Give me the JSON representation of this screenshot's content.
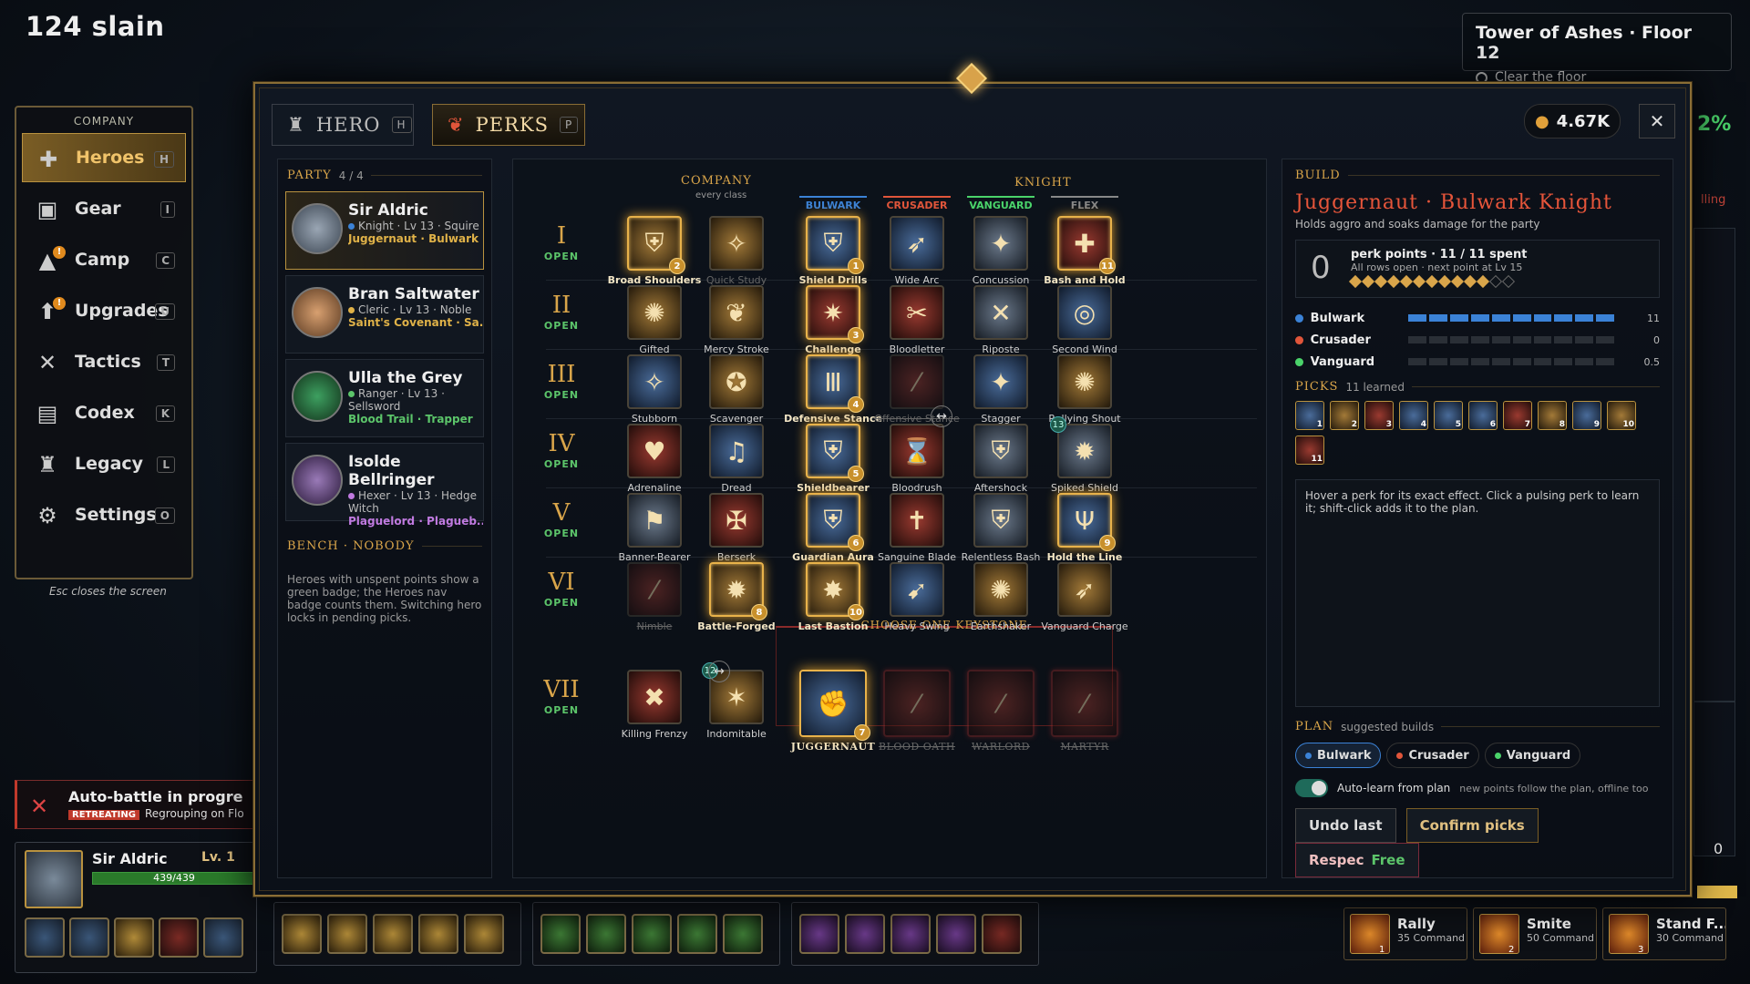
{
  "hud": {
    "slain": "124 slain",
    "quest_title": "Tower of Ashes · Floor 12",
    "quest_obj": "Clear the floor",
    "pct": "2%",
    "illing": "lling",
    "bg_num": "0"
  },
  "nav": {
    "header": "COMPANY",
    "items": [
      {
        "label": "Heroes",
        "key": "H",
        "icon": "✚"
      },
      {
        "label": "Gear",
        "key": "I",
        "icon": "▣"
      },
      {
        "label": "Camp",
        "key": "C",
        "icon": "▲"
      },
      {
        "label": "Upgrades",
        "key": "U",
        "icon": "⬆"
      },
      {
        "label": "Tactics",
        "key": "T",
        "icon": "✕"
      },
      {
        "label": "Codex",
        "key": "K",
        "icon": "▤"
      },
      {
        "label": "Legacy",
        "key": "L",
        "icon": "♜"
      },
      {
        "label": "Settings",
        "key": "O",
        "icon": "⚙"
      }
    ],
    "esc": "Esc closes the screen"
  },
  "auto": {
    "title": "Auto-battle in progress...",
    "tag": "RETREATING",
    "sub": "Regrouping on Flo"
  },
  "hero_card": {
    "name": "Sir Aldric",
    "lv": "Lv. 1",
    "hp": "439/439"
  },
  "commands": [
    {
      "name": "Rally",
      "cost": "35 Command",
      "key": "1"
    },
    {
      "name": "Smite",
      "cost": "50 Command",
      "key": "2"
    },
    {
      "name": "Stand F...",
      "cost": "30 Command",
      "key": "3"
    }
  ],
  "window": {
    "tab_hero": "HERO",
    "tab_hero_key": "H",
    "tab_perks": "PERKS",
    "tab_perks_key": "P",
    "gold": "4.67K",
    "close": "✕"
  },
  "party": {
    "header": "PARTY",
    "count": "4 / 4",
    "members": [
      {
        "name": "Sir Aldric",
        "desc": "Knight · Lv 13 · Squire",
        "spec": "Juggernaut · Bulwark",
        "dot": "#3b82d6"
      },
      {
        "name": "Bran Saltwater",
        "desc": "Cleric · Lv 13 · Noble",
        "spec": "Saint's Covenant · Sa...",
        "dot": "#e0b248"
      },
      {
        "name": "Ulla the Grey",
        "desc": "Ranger · Lv 13 · Sellsword",
        "spec": "Blood Trail · Trapper",
        "dot": "#5cc56a"
      },
      {
        "name": "Isolde Bellringer",
        "desc": "Hexer · Lv 13 · Hedge Witch",
        "spec": "Plaguelord · Plagueb...",
        "dot": "#c07ae0"
      }
    ],
    "bench": "BENCH · NOBODY",
    "note": "Heroes with unspent points show a green badge; the Heroes nav badge counts them. Switching hero locks in pending picks."
  },
  "grid": {
    "company": "COMPANY",
    "company_sub": "every class",
    "knight": "KNIGHT",
    "subcols": [
      {
        "name": "BULWARK",
        "color": "#3b82d6"
      },
      {
        "name": "CRUSADER",
        "color": "#e0553a"
      },
      {
        "name": "VANGUARD",
        "color": "#4ad36a"
      },
      {
        "name": "FLEX",
        "color": "#888888"
      }
    ],
    "rows": [
      "I",
      "II",
      "III",
      "IV",
      "V",
      "VI",
      "VII"
    ],
    "open": "OPEN",
    "keystone": "CHOOSE ONE KEYSTONE",
    "perks": [
      [
        "Broad Shoulders",
        "Quick Study",
        "Shield Drills",
        "Wide Arc",
        "Concussion",
        "Bash and Hold"
      ],
      [
        "Gifted",
        "Mercy Stroke",
        "Challenge",
        "Bloodletter",
        "Riposte",
        "Second Wind"
      ],
      [
        "Stubborn",
        "Scavenger",
        "Defensive Stance",
        "Offensive Stance",
        "Stagger",
        "Rallying Shout"
      ],
      [
        "Adrenaline",
        "Dread",
        "Shieldbearer",
        "Bloodrush",
        "Aftershock",
        "Spiked Shield"
      ],
      [
        "Banner-Bearer",
        "Berserk",
        "Guardian Aura",
        "Sanguine Blade",
        "Relentless Bash",
        "Hold the Line"
      ],
      [
        "Nimble",
        "Battle-Forged",
        "Last Bastion",
        "Heavy Swing",
        "Earthshaker",
        "Vanguard Charge"
      ],
      [
        "Killing Frenzy",
        "Indomitable",
        "JUGGERNAUT",
        "BLOOD OATH",
        "WARLORD",
        "MARTYR"
      ]
    ],
    "nums": {
      "0-0": "2",
      "0-2": "1",
      "0-5": "11",
      "1-2": "3",
      "2-2": "4",
      "3-2": "5",
      "4-2": "6",
      "4-5": "9",
      "5-1": "8",
      "5-2": "10",
      "6-2": "7"
    },
    "tnums": {
      "3-5": "13",
      "6-1": "12"
    }
  },
  "build": {
    "header": "BUILD",
    "title": "Juggernaut · Bulwark Knight",
    "desc": "Holds aggro and soaks damage for the party",
    "pp_big": "0",
    "pp_title": "perk points · 11 / 11 spent",
    "pp_sub": "All rows open · next point at Lv 15",
    "pp_filled": 11,
    "pp_total": 13,
    "aff": [
      {
        "name": "Bulwark",
        "color": "#3b82d6",
        "value": "11",
        "fill": 10
      },
      {
        "name": "Crusader",
        "color": "#e0553a",
        "value": "0",
        "fill": 0
      },
      {
        "name": "Vanguard",
        "color": "#4ad36a",
        "value": "0.5",
        "fill": 0
      }
    ],
    "picks_hdr": "PICKS",
    "picks_sub": "11 learned",
    "picks": [
      "1",
      "2",
      "3",
      "4",
      "5",
      "6",
      "7",
      "8",
      "9",
      "10",
      "11"
    ],
    "hover": "Hover a perk for its exact effect. Click a pulsing perk to learn it; shift-click adds it to the plan.",
    "plan": "PLAN",
    "plan_sub": "suggested builds",
    "chips": [
      {
        "name": "Bulwark",
        "color": "#3b82d6"
      },
      {
        "name": "Crusader",
        "color": "#e0553a"
      },
      {
        "name": "Vanguard",
        "color": "#4ad36a"
      }
    ],
    "auto_label": "Auto-learn from plan",
    "auto_sub": "new points follow the plan, offline too",
    "undo": "Undo last",
    "confirm": "Confirm picks",
    "respec": "Respec",
    "respec_cost": "Free"
  }
}
